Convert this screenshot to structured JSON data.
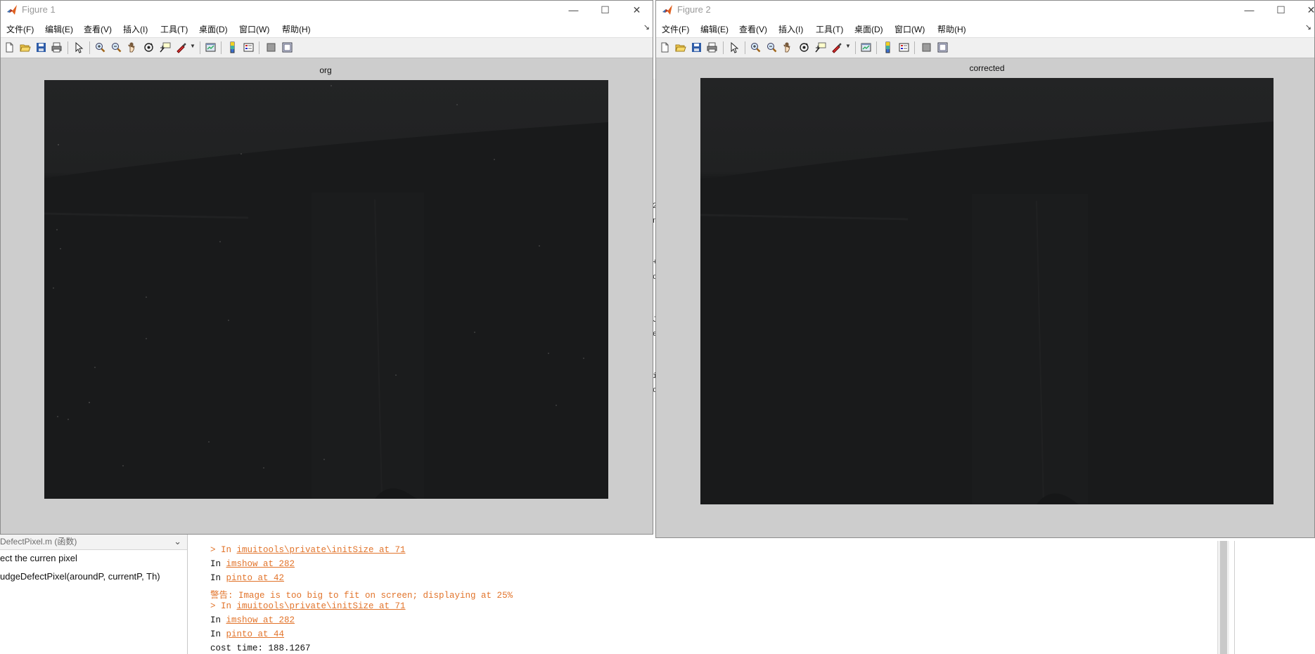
{
  "figure1": {
    "title": "Figure 1",
    "axes_title": "org"
  },
  "figure2": {
    "title": "Figure 2",
    "axes_title": "corrected"
  },
  "menu": [
    "文件(F)",
    "编辑(E)",
    "查看(V)",
    "插入(I)",
    "工具(T)",
    "桌面(D)",
    "窗口(W)",
    "帮助(H)"
  ],
  "window_controls": {
    "minimize": "—",
    "maximize": "☐",
    "close": "✕"
  },
  "toolbar_icons": [
    "new-figure-icon",
    "open-file-icon",
    "save-icon",
    "print-icon",
    "edit-plot-icon",
    "zoom-in-icon",
    "zoom-out-icon",
    "pan-icon",
    "rotate-3d-icon",
    "data-cursor-icon",
    "brush-icon",
    "link-plot-icon",
    "colorbar-icon",
    "legend-icon",
    "hide-plot-tools-icon",
    "show-plot-tools-icon"
  ],
  "function_browser": {
    "header": "DefectPixel.m (函数)",
    "lines": [
      "ect the curren pixel",
      "udgeDefectPixel(aroundP, currentP, Th)"
    ]
  },
  "command_window": {
    "lines": [
      {
        "type": "link",
        "prefix": "> In ",
        "link": "imuitools\\private\\initSize at 71"
      },
      {
        "type": "link",
        "prefix": "  In ",
        "link": "imshow at 282"
      },
      {
        "type": "link",
        "prefix": "  In ",
        "link": "pinto at 42"
      },
      {
        "type": "warning",
        "text": "警告: Image is too big to fit on screen; displaying at 25%"
      },
      {
        "type": "link",
        "prefix": "> In ",
        "link": "imuitools\\private\\initSize at 71"
      },
      {
        "type": "link",
        "prefix": "  In ",
        "link": "imshow at 282"
      },
      {
        "type": "link",
        "prefix": "  In ",
        "link": "pinto at 44"
      },
      {
        "type": "plain",
        "text": "cost time: 188.1267"
      }
    ]
  },
  "background_fragments": [
    "2",
    "n",
    "+",
    "c",
    "J",
    "e",
    "i",
    "c"
  ]
}
